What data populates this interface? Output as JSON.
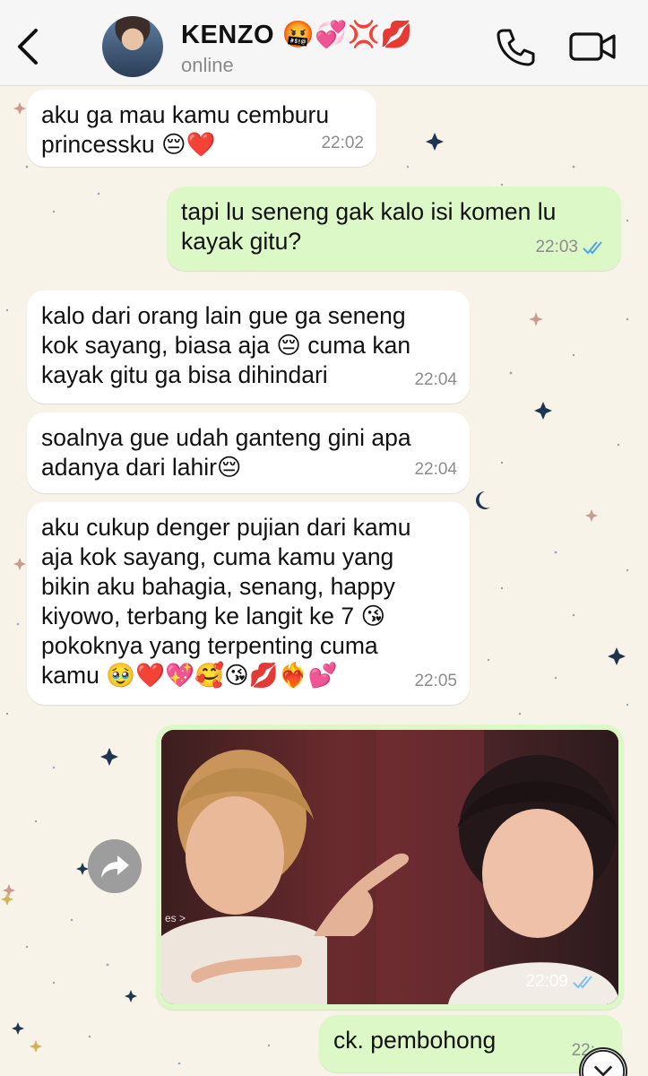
{
  "header": {
    "contact_name": "KENZO 🤬💞💢💋",
    "status": "online",
    "icons": [
      "back-chevron-icon",
      "phone-icon",
      "video-camera-icon"
    ]
  },
  "messages": [
    {
      "direction": "in",
      "text": "aku ga mau kamu cemburu\nprincessku 😔❤️",
      "time": "22:02"
    },
    {
      "direction": "out",
      "text": "tapi lu seneng gak kalo isi komen lu\nkayak gitu?",
      "time": "22:03",
      "read": true
    },
    {
      "direction": "in",
      "text": "kalo dari orang lain gue ga seneng\nkok sayang, biasa aja 😔 cuma kan\nkayak gitu ga bisa dihindari",
      "time": "22:04"
    },
    {
      "direction": "in",
      "text": "soalnya gue udah ganteng gini apa\nadanya dari lahir😔",
      "time": "22:04"
    },
    {
      "direction": "in",
      "text": "aku cukup denger pujian dari kamu\naja kok sayang, cuma kamu yang\nbikin aku bahagia, senang, happy\nkiyowo, terbang ke langit ke 7 😘\npokoknya yang terpenting cuma\nkamu 🥹❤️💖🥰😘💋❤️‍🔥💕",
      "time": "22:05"
    },
    {
      "direction": "out",
      "type": "photo",
      "time": "22:09",
      "read": true
    },
    {
      "direction": "out",
      "text": "ck. pembohong",
      "time": "22:"
    }
  ],
  "colors": {
    "chat_bg": "#f7f3e8",
    "incoming": "#ffffff",
    "outgoing": "#dcf8c6",
    "read_ticks": "#4fa3e6"
  }
}
